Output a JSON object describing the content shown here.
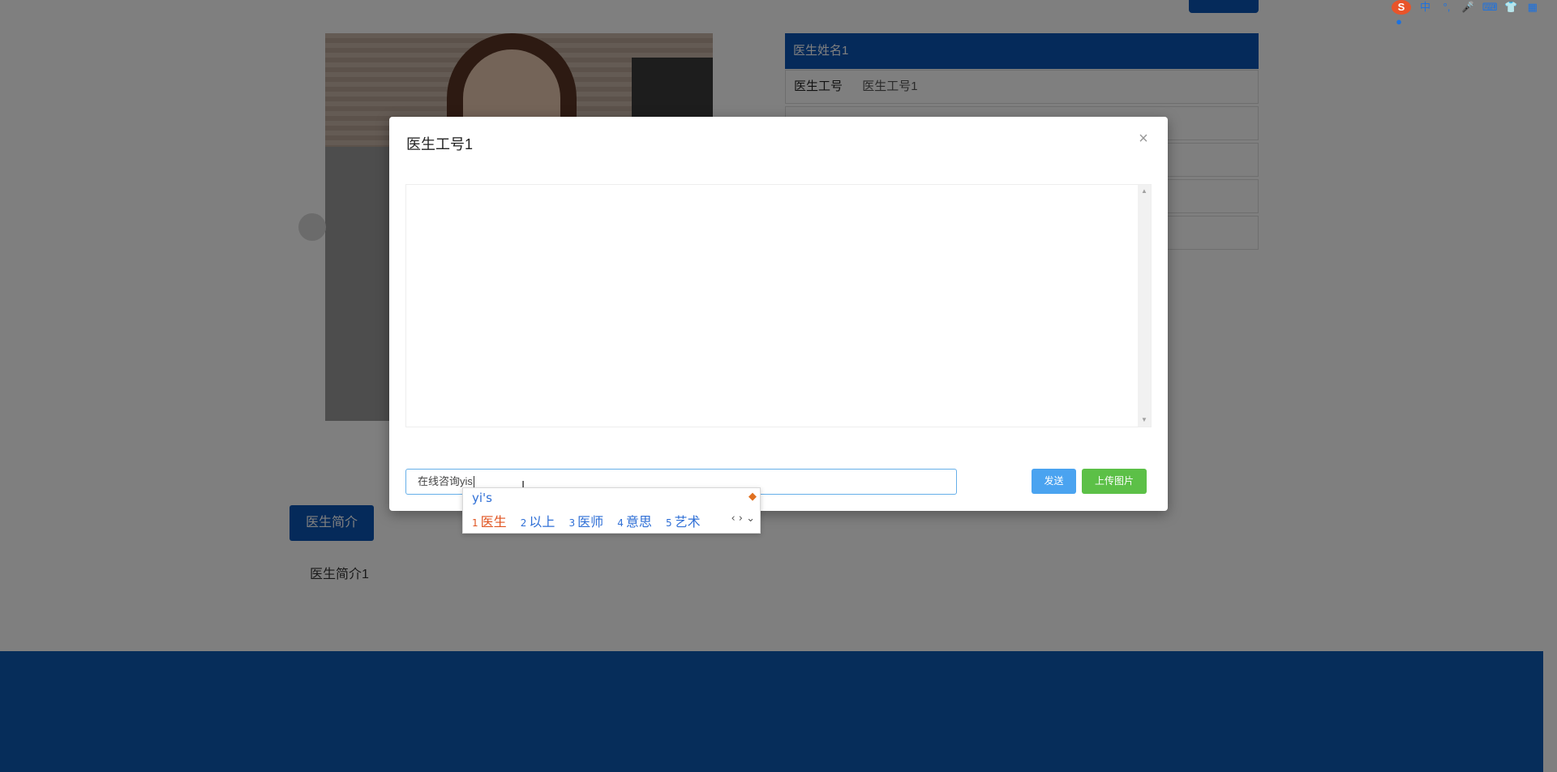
{
  "page": {
    "top_button_label": "",
    "doctor_name": "医生姓名1",
    "doctor_id_label": "医生工号",
    "doctor_id_value": "医生工号1",
    "intro_button_label": "医生简介",
    "intro_text": "医生简介1"
  },
  "modal": {
    "title": "医生工号1",
    "close_symbol": "×",
    "input_value": "在线咨询yis",
    "send_label": "发送",
    "upload_label": "上传图片"
  },
  "ime": {
    "composition": "yi's",
    "candidates": [
      {
        "num": "1",
        "text": "医生"
      },
      {
        "num": "2",
        "text": "以上"
      },
      {
        "num": "3",
        "text": "医师"
      },
      {
        "num": "4",
        "text": "意思"
      },
      {
        "num": "5",
        "text": "艺术"
      }
    ],
    "nav": "‹ › ⌄"
  },
  "tray": {
    "logo": "S",
    "lang": "中",
    "punct": "°,",
    "icons": [
      "mic-icon",
      "keyboard-icon",
      "skin-icon",
      "apps-icon",
      "mascot-icon"
    ]
  },
  "colors": {
    "primary": "#0a55b4",
    "send": "#4aa3f0",
    "upload": "#5cc047",
    "footer": "#0d5bb5"
  }
}
